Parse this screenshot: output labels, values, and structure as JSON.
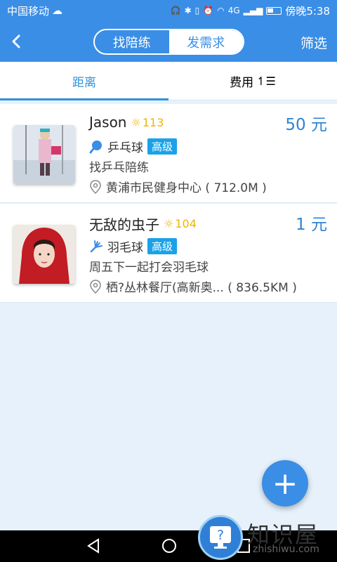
{
  "status_bar": {
    "carrier": "中国移动",
    "time": "傍晚5:38",
    "signal_text": "4G"
  },
  "navbar": {
    "segments": [
      "找陪练",
      "发需求"
    ],
    "active_segment": "发需求",
    "filter_label": "筛选"
  },
  "tabs": [
    {
      "label": "距离",
      "active": true
    },
    {
      "label": "费用",
      "active": false
    }
  ],
  "list": [
    {
      "name": "Jason",
      "level": "113",
      "price": "50 元",
      "sport": "乒乓球",
      "sport_icon": "ping-pong-icon",
      "skill_badge": "高级",
      "description": "找乒乓陪练",
      "location": "黄浦市民健身中心 ( 712.0M )"
    },
    {
      "name": "无敌的虫子",
      "level": "104",
      "price": "1 元",
      "sport": "羽毛球",
      "sport_icon": "badminton-icon",
      "skill_badge": "高级",
      "description": "周五下一起打会羽毛球",
      "location": "栖?丛林餐厅(高新奥... ( 836.5KM )"
    }
  ],
  "fab": {
    "label": "+"
  },
  "watermark": {
    "text": "知识屋",
    "url": "zhishiwu.com"
  },
  "colors": {
    "primary": "#3a8ee6",
    "accent": "#2f93d9",
    "badge": "#1aa2e8",
    "level": "#f0b400",
    "background": "#e6f1fb"
  }
}
